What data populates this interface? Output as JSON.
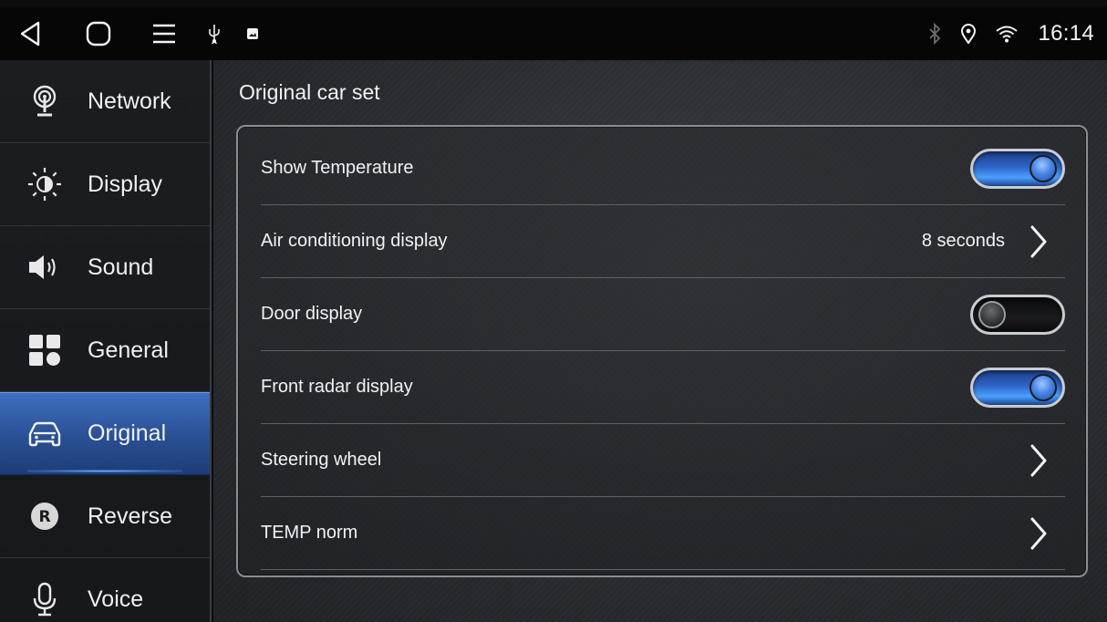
{
  "statusbar": {
    "time": "16:14",
    "icons_left": [
      "back-icon",
      "home-icon",
      "menu-icon",
      "usb-icon",
      "image-icon"
    ],
    "icons_right": [
      "bluetooth-icon",
      "location-icon",
      "wifi-icon"
    ]
  },
  "sidebar": {
    "items": [
      {
        "label": "Network",
        "icon": "network-icon",
        "active": false
      },
      {
        "label": "Display",
        "icon": "brightness-icon",
        "active": false
      },
      {
        "label": "Sound",
        "icon": "speaker-icon",
        "active": false
      },
      {
        "label": "General",
        "icon": "grid-icon",
        "active": false
      },
      {
        "label": "Original",
        "icon": "car-icon",
        "active": true
      },
      {
        "label": "Reverse",
        "icon": "reverse-icon",
        "active": false
      },
      {
        "label": "Voice",
        "icon": "microphone-icon",
        "active": false
      }
    ]
  },
  "main": {
    "title": "Original car set",
    "rows": [
      {
        "label": "Show Temperature",
        "control": "toggle",
        "on": true
      },
      {
        "label": "Air conditioning display",
        "control": "chevron",
        "value": "8 seconds"
      },
      {
        "label": "Door display",
        "control": "toggle",
        "on": false
      },
      {
        "label": "Front radar display",
        "control": "toggle",
        "on": true
      },
      {
        "label": "Steering wheel",
        "control": "chevron"
      },
      {
        "label": "TEMP norm",
        "control": "chevron"
      }
    ]
  },
  "colors": {
    "accent": "#2f64c8",
    "active_nav": "#2a4f93",
    "background": "#2a2c31",
    "statusbar": "#060606"
  }
}
